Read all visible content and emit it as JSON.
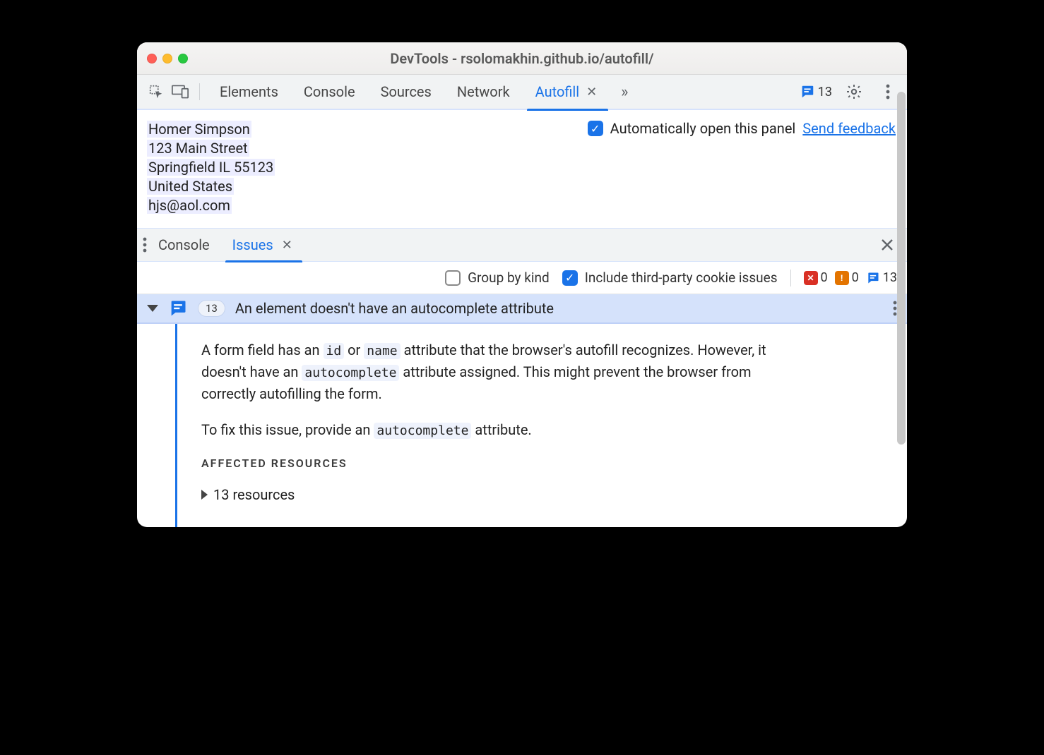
{
  "window": {
    "title": "DevTools - rsolomakhin.github.io/autofill/"
  },
  "tabs": {
    "items": [
      "Elements",
      "Console",
      "Sources",
      "Network",
      "Autofill"
    ],
    "active_index": 4,
    "message_count": "13"
  },
  "autofill": {
    "address": {
      "name": "Homer Simpson",
      "street": "123 Main Street",
      "city_state_zip": "Springfield IL 55123",
      "country": "United States",
      "email": "hjs@aol.com"
    },
    "auto_open_label": "Automatically open this panel",
    "feedback_label": "Send feedback"
  },
  "drawer": {
    "tabs": [
      "Console",
      "Issues"
    ],
    "active_index": 1
  },
  "issues_toolbar": {
    "group_by_kind_label": "Group by kind",
    "include_third_party_label": "Include third-party cookie issues",
    "group_by_kind_checked": false,
    "include_third_party_checked": true,
    "counters": {
      "errors": "0",
      "warnings": "0",
      "info": "13"
    }
  },
  "issue": {
    "count_badge": "13",
    "title": "An element doesn't have an autocomplete attribute",
    "body": {
      "p1_pre": "A form field has an ",
      "p1_code1": "id",
      "p1_mid1": " or ",
      "p1_code2": "name",
      "p1_mid2": " attribute that the browser's autofill recognizes. However, it doesn't have an ",
      "p1_code3": "autocomplete",
      "p1_post": " attribute assigned. This might prevent the browser from correctly autofilling the form.",
      "p2_pre": "To fix this issue, provide an ",
      "p2_code": "autocomplete",
      "p2_post": " attribute."
    },
    "affected_title": "AFFECTED RESOURCES",
    "resources_label": "13 resources"
  }
}
